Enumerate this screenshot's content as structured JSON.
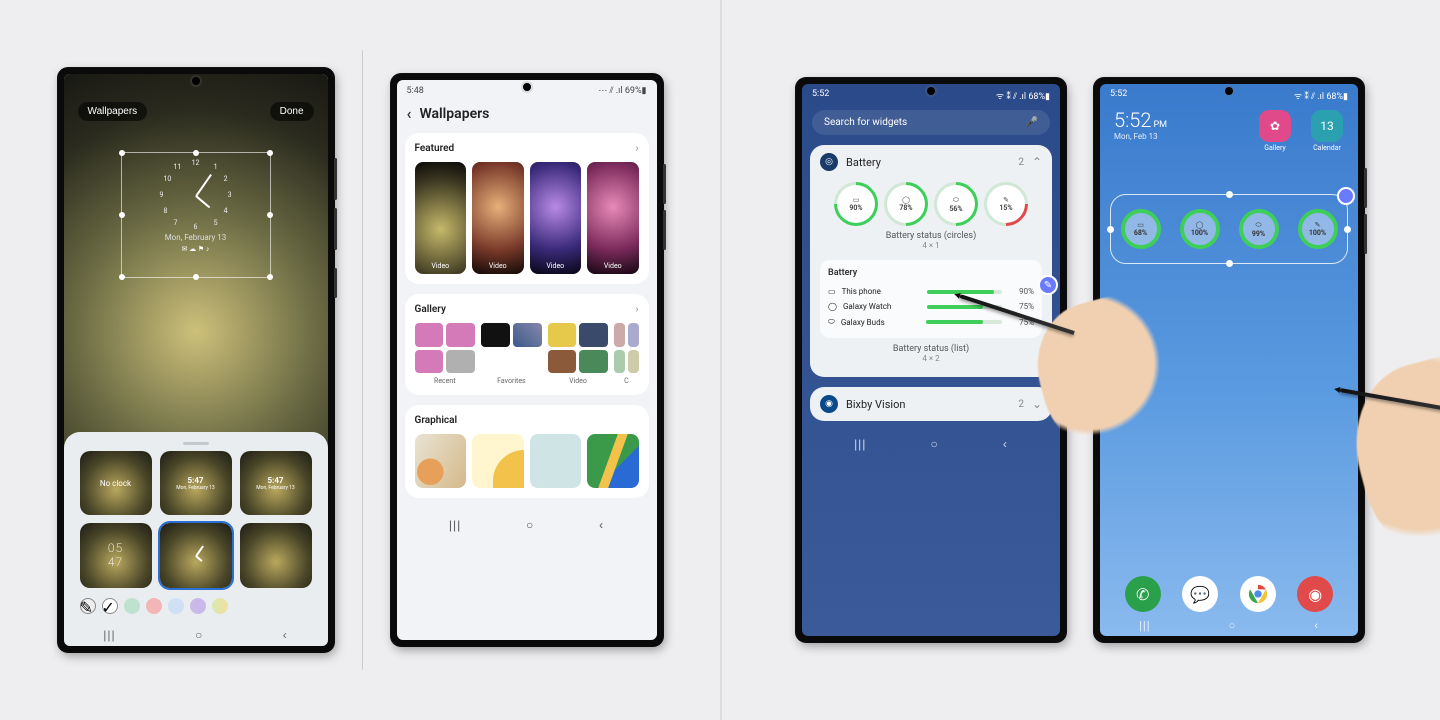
{
  "phoneA": {
    "top": {
      "wallpapers": "Wallpapers",
      "done": "Done"
    },
    "clock": {
      "nums": [
        "12",
        "1",
        "2",
        "3",
        "4",
        "5",
        "6",
        "7",
        "8",
        "9",
        "10",
        "11"
      ],
      "date": "Mon, February 13",
      "icons": "✉ ☁ ⚑ ♪"
    },
    "tray": {
      "items": [
        "No clock",
        "5:47",
        "5:47",
        "05\n47",
        "analog",
        "·"
      ],
      "times_sub": "Mon, February 13"
    },
    "colors": [
      "#f0f0f0",
      "#bfe1cf",
      "#f3b5b5",
      "#cfe0f5",
      "#c9b9e8",
      "#d7e9b0"
    ],
    "nav": {
      "recent": "|||",
      "home": "○",
      "back": "‹"
    }
  },
  "phoneB": {
    "status": {
      "time": "5:48",
      "right": "⋯ ⫽ .ıl 69%▮"
    },
    "header": "Wallpapers",
    "featured": {
      "title": "Featured",
      "label": "Video"
    },
    "gallery": {
      "title": "Gallery",
      "cols": [
        "Recent",
        "Favorites",
        "Video",
        "C"
      ]
    },
    "graphical": {
      "title": "Graphical"
    },
    "nav": {
      "recent": "|||",
      "home": "○",
      "back": "‹"
    }
  },
  "phoneC": {
    "status": {
      "time": "5:52",
      "right": "ᯤ ⁑ ⫽ .ıl 68%▮"
    },
    "search": {
      "placeholder": "Search for widgets",
      "mic": "🎤"
    },
    "cat": {
      "name": "Battery",
      "count": "2"
    },
    "circles": {
      "items": [
        {
          "icon": "▭",
          "pct": "90%"
        },
        {
          "icon": "◯",
          "pct": "78%"
        },
        {
          "icon": "⬭",
          "pct": "56%"
        },
        {
          "icon": "✎",
          "pct": "15%"
        }
      ],
      "label": "Battery status (circles)",
      "dim": "4 × 1"
    },
    "list": {
      "title": "Battery",
      "rows": [
        {
          "icon": "▭",
          "name": "This phone",
          "pct": "90%",
          "fill": 90
        },
        {
          "icon": "◯",
          "name": "Galaxy Watch",
          "pct": "75%",
          "fill": 75
        },
        {
          "icon": "⬭",
          "name": "Galaxy Buds",
          "pct": "75%",
          "fill": 75
        }
      ],
      "label": "Battery status (list)",
      "dim": "4 × 2"
    },
    "cat2": {
      "name": "Bixby Vision",
      "count": "2"
    },
    "nav": {
      "recent": "|||",
      "home": "○",
      "back": "‹"
    }
  },
  "phoneD": {
    "status": {
      "time": "5:52",
      "right": "ᯤ ⁑ ⫽ .ıl 68%▮"
    },
    "clock": {
      "time": "5:52",
      "ampm": "PM",
      "date": "Mon, Feb 13"
    },
    "apps": {
      "gallery": {
        "label": "Gallery",
        "icon": "✿",
        "day": ""
      },
      "calendar": {
        "label": "Calendar",
        "icon": "13"
      }
    },
    "widget": {
      "items": [
        {
          "icon": "▭",
          "pct": "68%"
        },
        {
          "icon": "◯",
          "pct": "100%"
        },
        {
          "icon": "⬭",
          "pct": "99%"
        },
        {
          "icon": "✎",
          "pct": "100%"
        }
      ]
    },
    "dock": [
      "phone",
      "messages",
      "chrome",
      "camera"
    ],
    "nav": {
      "recent": "|||",
      "home": "○",
      "back": "‹"
    }
  }
}
